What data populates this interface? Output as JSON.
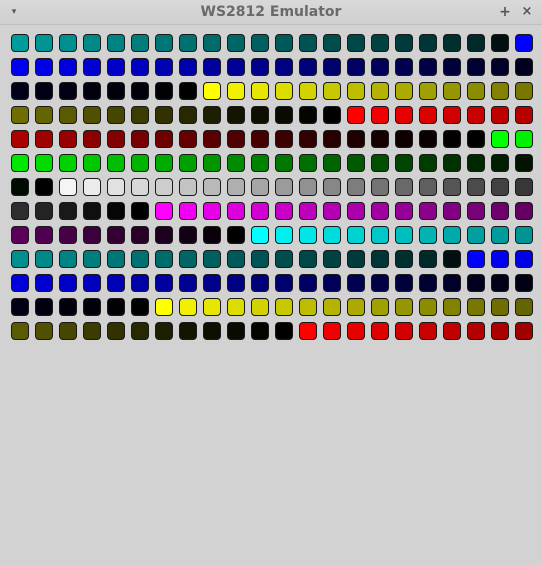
{
  "window": {
    "title": "WS2812 Emulator",
    "menu_icon": "chevron-down-icon",
    "maximize_icon": "plus-icon",
    "close_icon": "close-icon",
    "menu_glyph": "▾",
    "maximize_glyph": "+",
    "close_glyph": "×"
  },
  "leds": [
    "#009b9b",
    "#009595",
    "#008f8f",
    "#008989",
    "#008383",
    "#007d7d",
    "#007777",
    "#007171",
    "#006b6b",
    "#006565",
    "#005f5f",
    "#005959",
    "#005353",
    "#004d4d",
    "#004747",
    "#004141",
    "#003b3b",
    "#003535",
    "#002f2f",
    "#002929",
    "#001010",
    "#0000ff",
    "#0000f0",
    "#0000e6",
    "#0000dc",
    "#0000d2",
    "#0000c8",
    "#0000be",
    "#0000b4",
    "#0000aa",
    "#0000a0",
    "#000096",
    "#00008c",
    "#000082",
    "#000078",
    "#00006e",
    "#000064",
    "#00005a",
    "#000050",
    "#000046",
    "#00003c",
    "#000032",
    "#000028",
    "#00001e",
    "#000018",
    "#000014",
    "#000012",
    "#00000f",
    "#00000c",
    "#000008",
    "#000005",
    "#000000",
    "#ffff00",
    "#f0f000",
    "#e6e600",
    "#dcdc00",
    "#d2d200",
    "#c8c800",
    "#bebe00",
    "#b4b400",
    "#aaaa00",
    "#a0a000",
    "#969600",
    "#8c8c00",
    "#828200",
    "#787800",
    "#6e6e00",
    "#646400",
    "#5a5a00",
    "#505000",
    "#464600",
    "#3c3c00",
    "#323200",
    "#282800",
    "#1e1e00",
    "#141400",
    "#0f0f00",
    "#0a0a00",
    "#050500",
    "#000000",
    "#ff0000",
    "#f00000",
    "#e60000",
    "#dc0000",
    "#d20000",
    "#c80000",
    "#be0000",
    "#b40000",
    "#aa0000",
    "#a00000",
    "#960000",
    "#8c0000",
    "#820000",
    "#780000",
    "#6e0000",
    "#640000",
    "#5a0000",
    "#500000",
    "#460000",
    "#3c0000",
    "#320000",
    "#280000",
    "#1e0000",
    "#140000",
    "#0f0000",
    "#0a0000",
    "#050000",
    "#000000",
    "#00ff00",
    "#00f000",
    "#00e600",
    "#00dc00",
    "#00d200",
    "#00c800",
    "#00be00",
    "#00b400",
    "#00aa00",
    "#00a000",
    "#009600",
    "#008c00",
    "#008200",
    "#007800",
    "#006e00",
    "#006400",
    "#005a00",
    "#005000",
    "#004600",
    "#003c00",
    "#003200",
    "#002800",
    "#001e00",
    "#001400",
    "#000a00",
    "#000000",
    "#f5f5f5",
    "#ebebeb",
    "#e1e1e1",
    "#d7d7d7",
    "#cdcdcd",
    "#c3c3c3",
    "#b9b9b9",
    "#afafaf",
    "#a5a5a5",
    "#9b9b9b",
    "#919191",
    "#878787",
    "#7d7d7d",
    "#737373",
    "#696969",
    "#5f5f5f",
    "#555555",
    "#4b4b4b",
    "#414141",
    "#373737",
    "#2d2d2d",
    "#232323",
    "#191919",
    "#0f0f0f",
    "#050505",
    "#000000",
    "#ff00ff",
    "#f000f0",
    "#e600e6",
    "#dc00dc",
    "#d200d2",
    "#c800c8",
    "#be00be",
    "#b400b4",
    "#aa00aa",
    "#a000a0",
    "#960096",
    "#8c008c",
    "#820082",
    "#780078",
    "#6e006e",
    "#640064",
    "#5a005a",
    "#500050",
    "#460046",
    "#3c003c",
    "#320032",
    "#280028",
    "#1e001e",
    "#140014",
    "#0a000a",
    "#000000",
    "#00ffff",
    "#00f0f0",
    "#00e6e6",
    "#00dcdc",
    "#00d2d2",
    "#00c8c8",
    "#00bebe",
    "#00b4b4",
    "#00aaaa",
    "#00a0a0",
    "#009b9b",
    "#009595",
    "#008f8f",
    "#008989",
    "#008383",
    "#007d7d",
    "#007777",
    "#007171",
    "#006b6b",
    "#006565",
    "#005f5f",
    "#005959",
    "#005353",
    "#004d4d",
    "#004747",
    "#004141",
    "#003b3b",
    "#003535",
    "#002f2f",
    "#002929",
    "#001010",
    "#0000ff",
    "#0000f0",
    "#0000e6",
    "#0000dc",
    "#0000d2",
    "#0000c8",
    "#0000be",
    "#0000b4",
    "#0000aa",
    "#0000a0",
    "#000096",
    "#00008c",
    "#000082",
    "#000078",
    "#00006e",
    "#000064",
    "#00005a",
    "#000050",
    "#000046",
    "#00003c",
    "#000032",
    "#000028",
    "#00001e",
    "#000018",
    "#000014",
    "#000012",
    "#00000f",
    "#00000c",
    "#000008",
    "#000005",
    "#000000",
    "#ffff00",
    "#f0f000",
    "#e6e600",
    "#dcdc00",
    "#d2d200",
    "#c8c800",
    "#bebe00",
    "#b4b400",
    "#aaaa00",
    "#a0a000",
    "#969600",
    "#8c8c00",
    "#828200",
    "#787800",
    "#6e6e00",
    "#646400",
    "#5a5a00",
    "#505000",
    "#464600",
    "#3c3c00",
    "#323200",
    "#282800",
    "#1e1e00",
    "#141400",
    "#0f0f00",
    "#0a0a00",
    "#050500",
    "#000000",
    "#ff0000",
    "#f00000",
    "#e60000",
    "#dc0000",
    "#d20000",
    "#c80000",
    "#be0000",
    "#b40000",
    "#aa0000",
    "#a00000"
  ]
}
